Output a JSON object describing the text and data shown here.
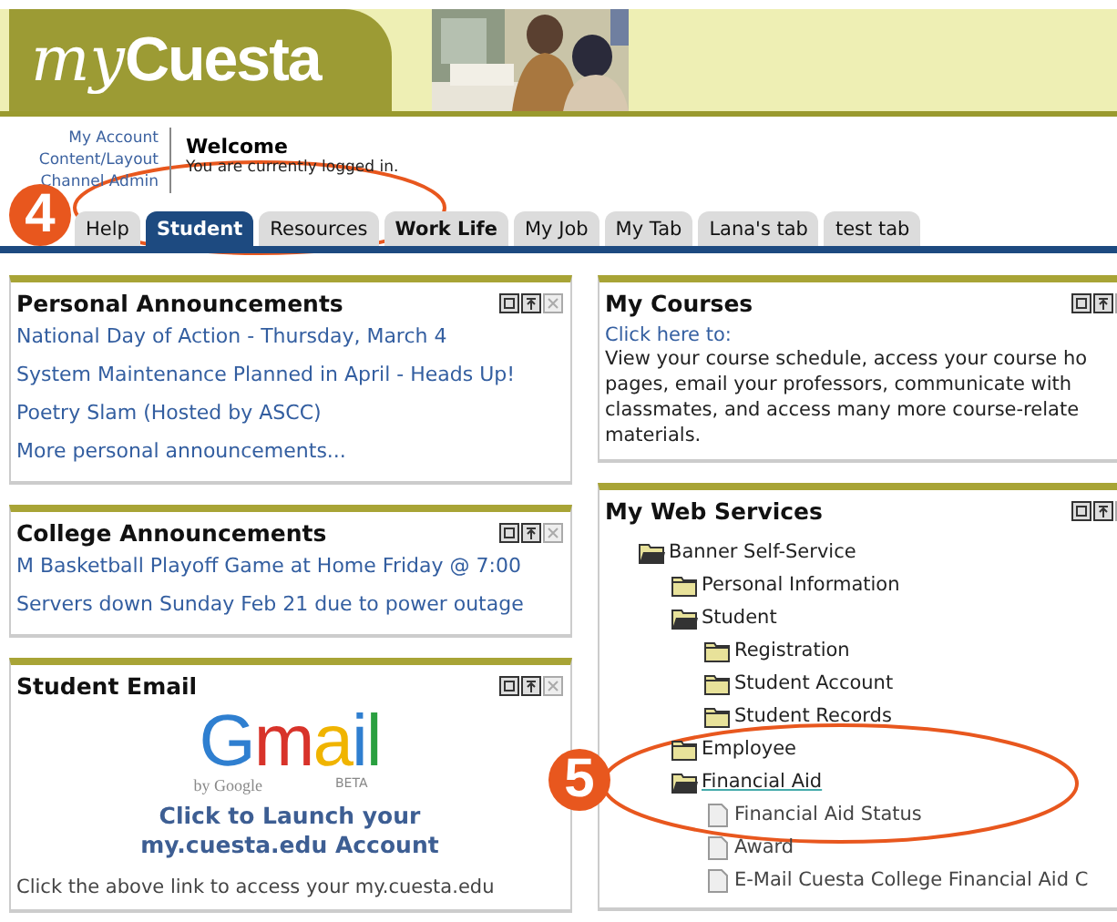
{
  "header": {
    "logo": {
      "script": "my",
      "word": "Cuesta"
    }
  },
  "account_links": [
    "My Account",
    "Content/Layout",
    "Channel Admin"
  ],
  "welcome": {
    "title": "Welcome",
    "message": "You are currently logged in."
  },
  "tabs": [
    {
      "label": "Help",
      "selected": false,
      "bold": false
    },
    {
      "label": "Student",
      "selected": true,
      "bold": true
    },
    {
      "label": "Resources",
      "selected": false,
      "bold": false
    },
    {
      "label": "Work Life",
      "selected": false,
      "bold": true
    },
    {
      "label": "My Job",
      "selected": false,
      "bold": false
    },
    {
      "label": "My Tab",
      "selected": false,
      "bold": false
    },
    {
      "label": "Lana's tab",
      "selected": false,
      "bold": false
    },
    {
      "label": "test tab",
      "selected": false,
      "bold": false
    }
  ],
  "left_column": [
    {
      "kind": "links",
      "title": "Personal Announcements",
      "links": [
        "National Day of Action - Thursday, March 4",
        "System Maintenance Planned in April - Heads Up!",
        "Poetry Slam (Hosted by ASCC)",
        "More personal announcements..."
      ]
    },
    {
      "kind": "links",
      "title": "College Announcements",
      "links": [
        "M Basketball Playoff Game at Home Friday @ 7:00",
        "Servers down Sunday Feb 21 due to power outage"
      ]
    },
    {
      "kind": "email",
      "title": "Student Email",
      "logo": {
        "word": "Gmail",
        "by": "by Google",
        "beta": "BETA"
      },
      "launch": [
        "Click to Launch your",
        "my.cuesta.edu Account"
      ],
      "note": "Click the above link to access your my.cuesta.edu"
    }
  ],
  "right_column": [
    {
      "kind": "text",
      "title": "My Courses",
      "link": "Click here to:",
      "lines": [
        "View your course schedule, access your course ho",
        "pages, email your professors, communicate with",
        "classmates, and access many more course-relate",
        "materials."
      ]
    },
    {
      "kind": "tree",
      "title": "My Web Services",
      "tree": [
        {
          "label": "Banner Self-Service",
          "kind": "folder",
          "expanded": true,
          "children": [
            {
              "label": "Personal Information",
              "kind": "folder",
              "expanded": false
            },
            {
              "label": "Student",
              "kind": "folder",
              "expanded": true,
              "children": [
                {
                  "label": "Registration",
                  "kind": "folder",
                  "expanded": false
                },
                {
                  "label": "Student Account",
                  "kind": "folder",
                  "expanded": false
                },
                {
                  "label": "Student Records",
                  "kind": "folder",
                  "expanded": false
                }
              ]
            },
            {
              "label": "Employee",
              "kind": "folder",
              "expanded": false
            },
            {
              "label": "Financial Aid",
              "kind": "folder",
              "expanded": true,
              "children": [
                {
                  "label": "Financial Aid Status",
                  "kind": "document"
                },
                {
                  "label": "Award",
                  "kind": "document"
                },
                {
                  "label": "E-Mail Cuesta College Financial Aid C",
                  "kind": "document"
                }
              ]
            }
          ]
        }
      ]
    }
  ],
  "annotations": [
    {
      "number": "4"
    },
    {
      "number": "5"
    }
  ]
}
